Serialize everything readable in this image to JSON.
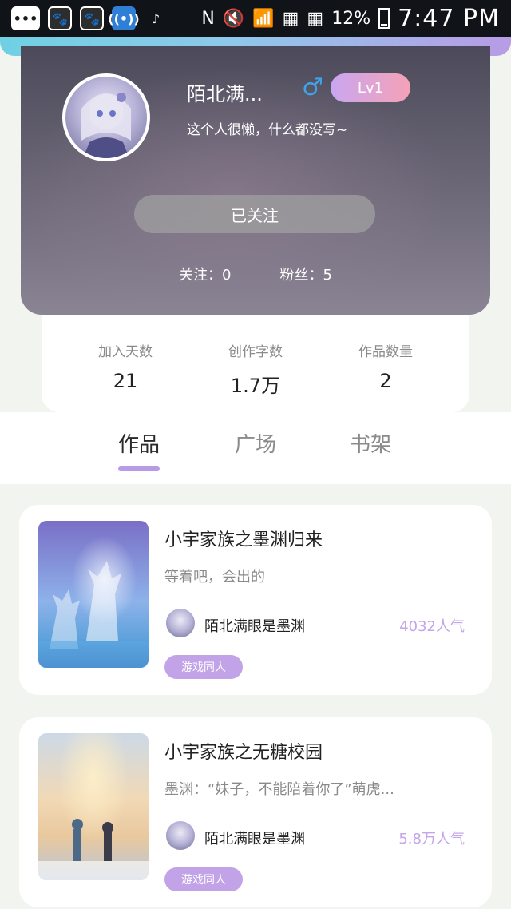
{
  "status_bar": {
    "icons": [
      "more-icon",
      "paw-icon",
      "paw-icon",
      "wifi-hotspot-icon",
      "tiktok-icon"
    ],
    "right_icons": [
      "nfc-icon",
      "mute-icon",
      "wifi-icon",
      "sim1-icon",
      "sim2-icon"
    ],
    "battery": "12%",
    "time": "7:47 PM"
  },
  "profile": {
    "username": "陌北满...",
    "gender_icon": "male-icon",
    "level": "Lv1",
    "bio": "这个人很懒，什么都没写~",
    "follow_button": "已关注",
    "following": "关注：0",
    "followers": "粉丝：5"
  },
  "stats": [
    {
      "label": "加入天数",
      "value": "21"
    },
    {
      "label": "创作字数",
      "value": "1.7万"
    },
    {
      "label": "作品数量",
      "value": "2"
    }
  ],
  "tabs": [
    {
      "label": "作品"
    },
    {
      "label": "广场"
    },
    {
      "label": "书架"
    }
  ],
  "works": [
    {
      "title": "小宇家族之墨渊归来",
      "description": "等着吧，会出的",
      "author": "陌北满眼是墨渊",
      "popularity": "4032人气",
      "tag": "游戏同人"
    },
    {
      "title": "小宇家族之无糖校园",
      "description": "墨渊：“妹子，不能陪着你了”萌虎...",
      "author": "陌北满眼是墨渊",
      "popularity": "5.8万人气",
      "tag": "游戏同人"
    }
  ]
}
